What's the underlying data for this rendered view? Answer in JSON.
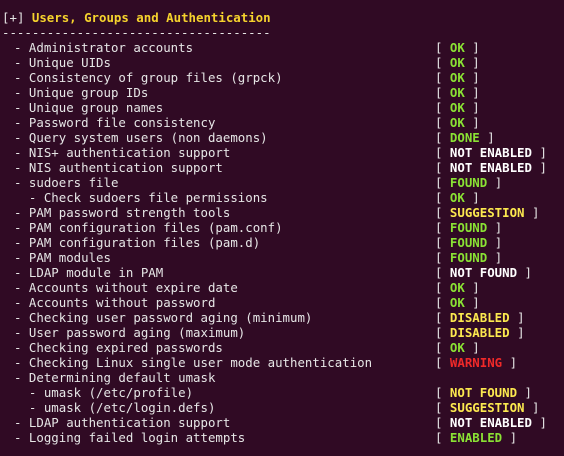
{
  "section": {
    "marker": "+",
    "title": "Users, Groups and Authentication",
    "separator": "------------------------------------"
  },
  "colors": {
    "background": "#300a24",
    "text": "#e6e6e6",
    "title": "#f6d32d",
    "green": "#8ae234",
    "yellow": "#fce94f",
    "white": "#ffffff",
    "red": "#ef2929"
  },
  "rows": [
    {
      "label": "- Administrator accounts",
      "status": "OK",
      "color": "green"
    },
    {
      "label": "- Unique UIDs",
      "status": "OK",
      "color": "green"
    },
    {
      "label": "- Consistency of group files (grpck)",
      "status": "OK",
      "color": "green"
    },
    {
      "label": "- Unique group IDs",
      "status": "OK",
      "color": "green"
    },
    {
      "label": "- Unique group names",
      "status": "OK",
      "color": "green"
    },
    {
      "label": "- Password file consistency",
      "status": "OK",
      "color": "green"
    },
    {
      "label": "- Query system users (non daemons)",
      "status": "DONE",
      "color": "green"
    },
    {
      "label": "- NIS+ authentication support",
      "status": "NOT ENABLED",
      "color": "white"
    },
    {
      "label": "- NIS authentication support",
      "status": "NOT ENABLED",
      "color": "white"
    },
    {
      "label": "- sudoers file",
      "status": "FOUND",
      "color": "green"
    },
    {
      "label": "  - Check sudoers file permissions",
      "status": "OK",
      "color": "green"
    },
    {
      "label": "- PAM password strength tools",
      "status": "SUGGESTION",
      "color": "yellow"
    },
    {
      "label": "- PAM configuration files (pam.conf)",
      "status": "FOUND",
      "color": "green"
    },
    {
      "label": "- PAM configuration files (pam.d)",
      "status": "FOUND",
      "color": "green"
    },
    {
      "label": "- PAM modules",
      "status": "FOUND",
      "color": "green"
    },
    {
      "label": "- LDAP module in PAM",
      "status": "NOT FOUND",
      "color": "white"
    },
    {
      "label": "- Accounts without expire date",
      "status": "OK",
      "color": "green"
    },
    {
      "label": "- Accounts without password",
      "status": "OK",
      "color": "green"
    },
    {
      "label": "- Checking user password aging (minimum)",
      "status": "DISABLED",
      "color": "yellow"
    },
    {
      "label": "- User password aging (maximum)",
      "status": "DISABLED",
      "color": "yellow"
    },
    {
      "label": "- Checking expired passwords",
      "status": "OK",
      "color": "green"
    },
    {
      "label": "- Checking Linux single user mode authentication",
      "status": "WARNING",
      "color": "red"
    },
    {
      "label": "- Determining default umask",
      "status": "",
      "color": ""
    },
    {
      "label": "  - umask (/etc/profile)",
      "status": "NOT FOUND",
      "color": "yellow"
    },
    {
      "label": "  - umask (/etc/login.defs)",
      "status": "SUGGESTION",
      "color": "yellow"
    },
    {
      "label": "- LDAP authentication support",
      "status": "NOT ENABLED",
      "color": "white"
    },
    {
      "label": "- Logging failed login attempts",
      "status": "ENABLED",
      "color": "green"
    }
  ]
}
